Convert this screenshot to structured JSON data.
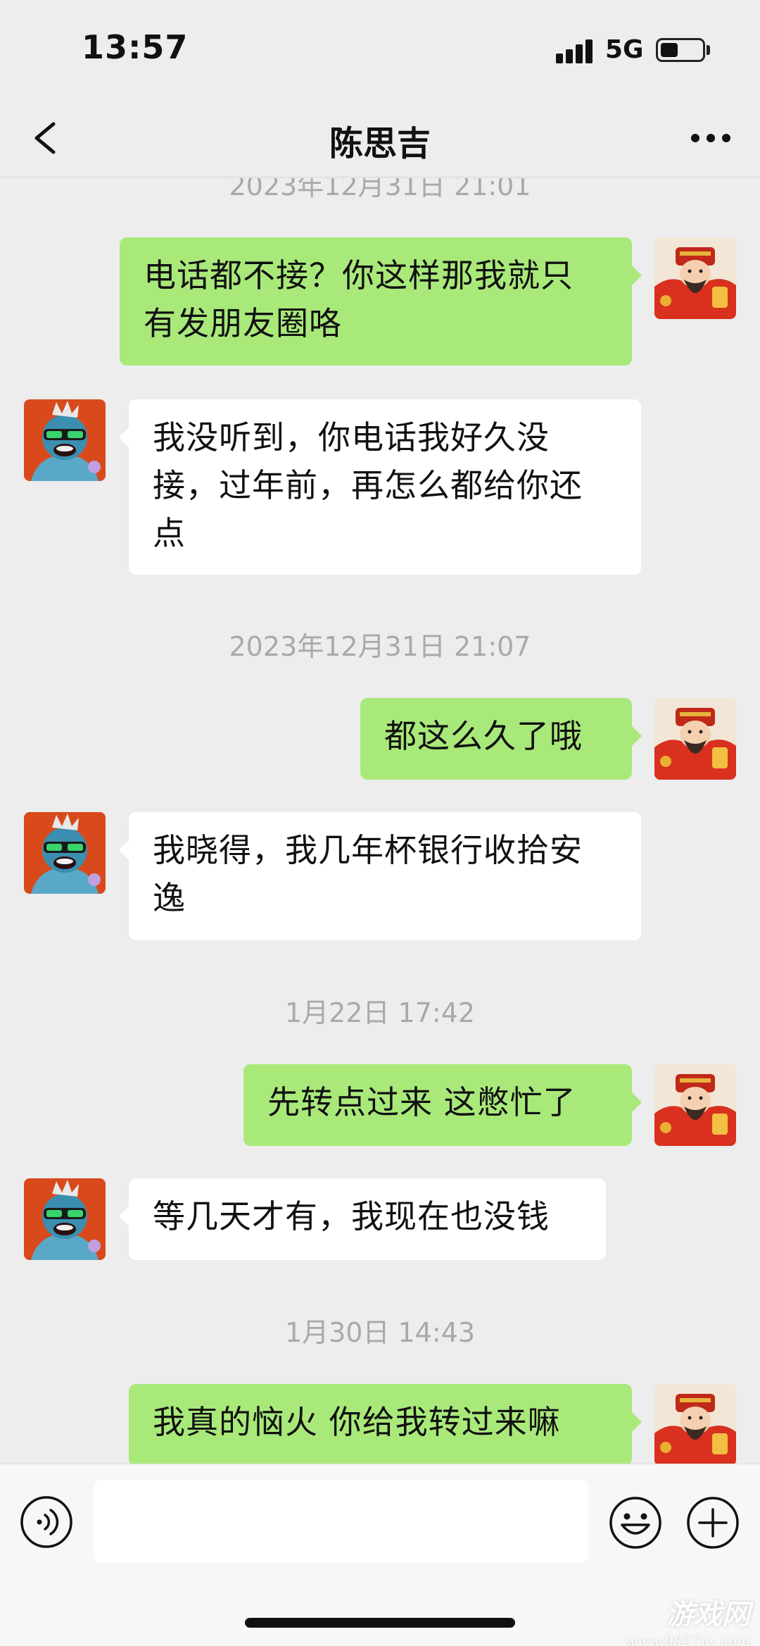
{
  "status_bar": {
    "time": "13:57",
    "network": "5G",
    "battery_level": 0.42,
    "signal_bars": 4
  },
  "header": {
    "back_icon": "chevron-left-icon",
    "title": "陈思吉",
    "more_icon": "ellipsis-icon"
  },
  "conversation": {
    "timestamps": [
      "2023年12月31日 21:01",
      "2023年12月31日 21:07",
      "1月22日 17:42",
      "1月30日 14:43"
    ],
    "messages": [
      {
        "direction": "out",
        "lines": [
          "电话都不接？你这样那我就只",
          "有发朋友圈咯"
        ]
      },
      {
        "direction": "in",
        "lines": [
          "我没听到，你电话我好久没",
          "接，过年前，再怎么都给你还",
          "点"
        ]
      },
      {
        "direction": "out",
        "lines": [
          "都这么久了哦"
        ]
      },
      {
        "direction": "in",
        "lines": [
          "我晓得，我几年杯银行收拾安",
          "逸"
        ]
      },
      {
        "direction": "out",
        "lines": [
          "先转点过来 这憋忙了"
        ]
      },
      {
        "direction": "in",
        "lines": [
          "等几天才有，我现在也没钱"
        ]
      },
      {
        "direction": "out",
        "lines": [
          "我真的恼火 你给我转过来嘛"
        ]
      }
    ]
  },
  "input_bar": {
    "voice_icon": "voice-icon",
    "input_value": "",
    "emoji_icon": "emoji-icon",
    "plus_icon": "plus-icon"
  },
  "watermark": {
    "main": "游戏网",
    "sub": "www.0827yx.com"
  },
  "colors": {
    "background": "#ededed",
    "outgoing_bubble": "#a9e97a",
    "incoming_bubble": "#ffffff",
    "timestamp_text": "#a9a9a9"
  }
}
